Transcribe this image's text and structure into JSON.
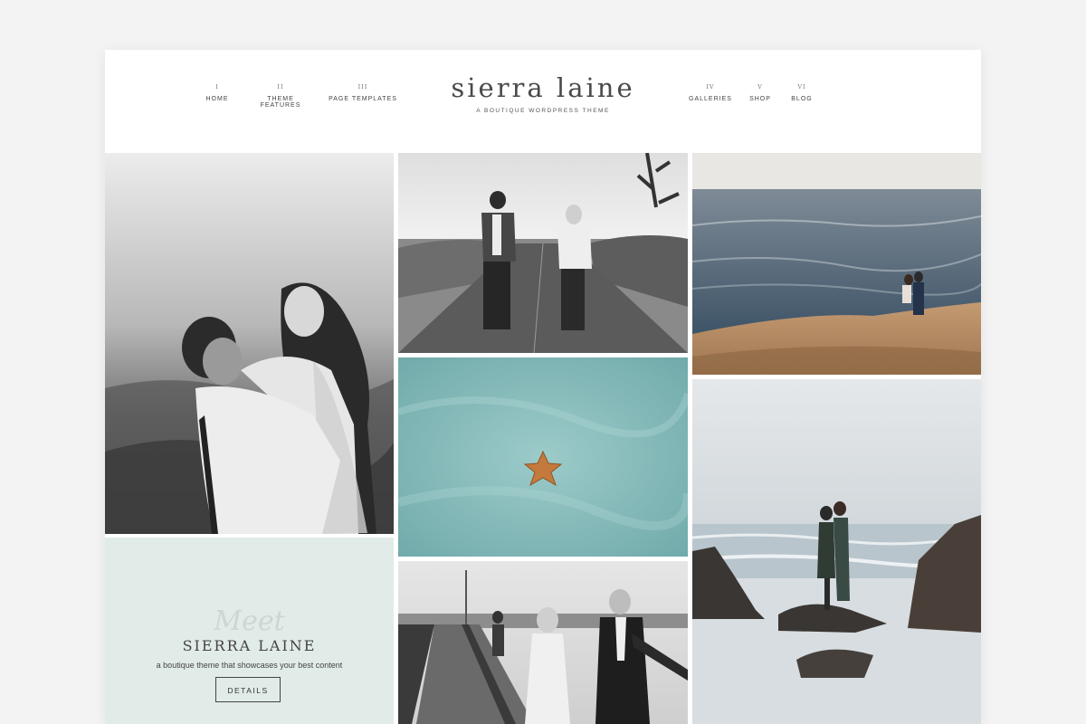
{
  "header": {
    "logo_title": "sierra laine",
    "logo_tagline": "A BOUTIQUE WORDPRESS THEME",
    "nav_left": [
      {
        "num": "I",
        "label": "HOME"
      },
      {
        "num": "II",
        "label": "THEME FEATURES"
      },
      {
        "num": "III",
        "label": "PAGE TEMPLATES"
      }
    ],
    "nav_right": [
      {
        "num": "IV",
        "label": "GALLERIES"
      },
      {
        "num": "V",
        "label": "SHOP"
      },
      {
        "num": "VI",
        "label": "BLOG"
      }
    ]
  },
  "meet": {
    "script": "Meet",
    "title": "SIERRA LAINE",
    "subtitle": "a boutique theme that showcases your best content",
    "button_label": "DETAILS"
  },
  "gallery": {
    "photos": [
      {
        "subject": "couple embracing on hillside, black and white"
      },
      {
        "subject": "couple holding hands on desert road, black and white"
      },
      {
        "subject": "couple standing on coastal cliff by the ocean"
      },
      {
        "subject": "starfish on turquoise sand"
      },
      {
        "subject": "couple kissing on rocks at the beach"
      },
      {
        "subject": "bride and groom walking on pier, black and white"
      }
    ]
  },
  "colors": {
    "page_background": "#f3f3f3",
    "meet_panel": "#e1ebe8",
    "text_dark": "#444444"
  }
}
